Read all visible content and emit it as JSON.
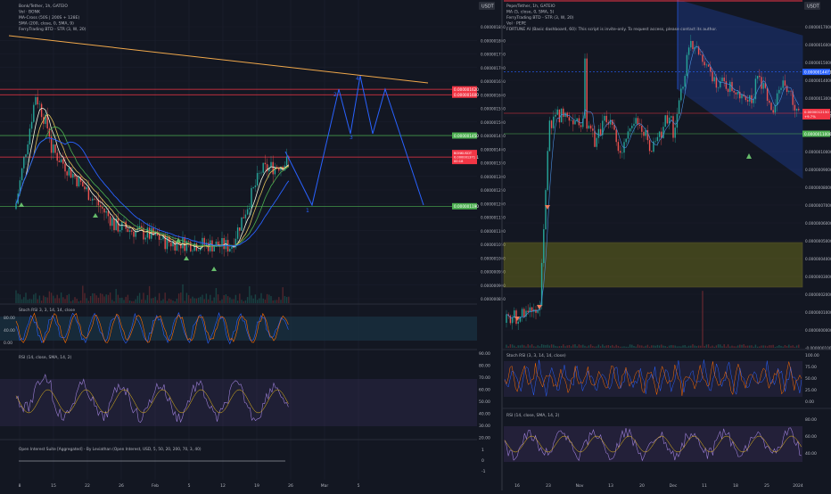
{
  "left": {
    "legend": [
      "Bonk/Tether, 1h, GATEIO",
      "Vol · BONK",
      "MA-Cross (50S | 200S + 128E)",
      "SMA (200, close, 0, SMA, 9)",
      "FerryTrading BTD - STR (3, W, 20)"
    ],
    "currency": "USDT",
    "price_ticks": [
      "0.000001850",
      "0.000001800",
      "0.000001750",
      "0.000001700",
      "0.000001650",
      "0.000001600",
      "0.000001550",
      "0.000001500",
      "0.000001450",
      "0.000001400",
      "0.000001350",
      "0.000001300",
      "0.000001250",
      "0.000001200",
      "0.000001150",
      "0.000001100",
      "0.000001050",
      "0.000001000",
      "0.000000950",
      "0.000000900",
      "0.000000850"
    ],
    "level_tags": [
      {
        "text": "0.000001620",
        "color": "#f23645",
        "price": 1.62e-06
      },
      {
        "text": "0.000001600",
        "color": "#f23645",
        "price": 1.6e-06
      },
      {
        "text": "0.000001450",
        "color": "#4caf50",
        "price": 1.45e-06
      },
      {
        "text": "0.000001371",
        "color": "#f23645",
        "price": 1.371e-06
      },
      {
        "text": "0.000001190",
        "color": "#4caf50",
        "price": 1.19e-06
      }
    ],
    "last_price_tag": {
      "label": "BONKUSDT",
      "price": "0.000001371",
      "extra": "00:18"
    },
    "wave_labels": [
      "1",
      "2",
      "3",
      "4"
    ],
    "stoch_legend": "Stoch RSI 3, 3, 14, 14, close",
    "stoch_ticks": [
      "80.00",
      "40.00",
      "0.00"
    ],
    "rsi_legend": "RSI (14, close, SMA, 14, 2)",
    "rsi_ticks": [
      "90.00",
      "80.00",
      "70.00",
      "60.00",
      "50.00",
      "40.00",
      "30.00",
      "20.00"
    ],
    "oi_legend": "Open Interest Suite [Aggregated] - By Leviathan (Open Interest, USD, 5, 50, 20, 200, 70, 3, 40)",
    "oi_ticks": [
      "1",
      "0",
      "-1"
    ],
    "time_ticks": [
      "8",
      "15",
      "22",
      "26",
      "Feb",
      "5",
      "12",
      "19",
      "26",
      "Mar",
      "5"
    ]
  },
  "right": {
    "legend": [
      "Pepe/Tether, 1h, GATEIO",
      "MA (5, close, 0, SMA, 5)",
      "FerryTrading BTD - STR (3, W, 20)",
      "Vol · PEPE",
      "FORTUNE AI (Basic dashboard, 60): This script is invite-only. To request access, please contact its author."
    ],
    "currency": "USDT",
    "price_ticks": [
      "0.0000017000",
      "0.0000016000",
      "0.0000015000",
      "0.0000014000",
      "0.0000013000",
      "0.0000012000",
      "0.0000011000",
      "0.0000010000",
      "0.0000009000",
      "0.0000008000",
      "0.0000007000",
      "0.0000006000",
      "0.0000005000",
      "0.0000004000",
      "0.0000003000",
      "0.0000002000",
      "0.0000001000",
      "0.0000000000",
      "-0.0000001000"
    ],
    "level_tags": [
      {
        "text": "0.0000014471",
        "color": "#2962ff",
        "price": 1.4471e-06
      },
      {
        "text": "0.0000012150",
        "color": "#f23645",
        "price": 1.215e-06
      },
      {
        "text": "0.0000011000",
        "color": "#4caf50",
        "price": 1.1e-06
      }
    ],
    "last_price_tag": {
      "price": "0.0000012150",
      "extra": "+9.7%"
    },
    "stoch_legend": "Stoch RSI (3, 3, 14, 14, close)",
    "stoch_ticks": [
      "100.00",
      "75.00",
      "50.00",
      "25.00",
      "0.00"
    ],
    "rsi_legend": "RSI (14, close, SMA, 14, 2)",
    "rsi_ticks": [
      "80.00",
      "60.00",
      "40.00"
    ],
    "time_ticks": [
      "16",
      "23",
      "Nov",
      "13",
      "20",
      "Dec",
      "11",
      "18",
      "25",
      "2024"
    ]
  },
  "colors": {
    "bg": "#131722",
    "grid": "#1e2230",
    "up": "#26a69a",
    "down": "#ef5350",
    "red_line": "#f23645",
    "green_line": "#4caf50",
    "blue": "#2962ff",
    "orange": "#f0a84b",
    "purple": "#7e57c2"
  }
}
